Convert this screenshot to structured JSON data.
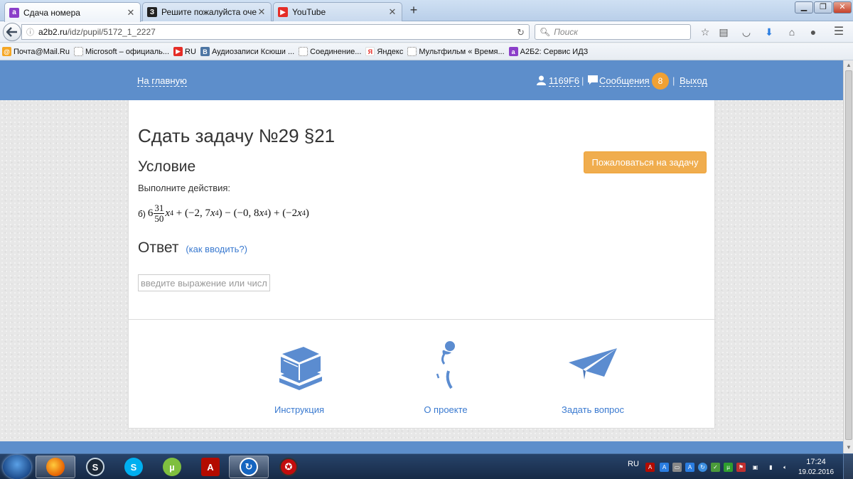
{
  "colors": {
    "header_blue": "#5d8ecb",
    "link_blue": "#3a7ad0",
    "orange": "#f0ad4e",
    "badge_orange": "#f0a134",
    "icon_blue": "#5b8cd0"
  },
  "browser": {
    "tabs": [
      {
        "label": "Сдача номера",
        "icon": "a2b2-icon",
        "active": true
      },
      {
        "label": "Решите пожалуйста очен...",
        "icon": "znanija-icon",
        "active": false
      },
      {
        "label": "YouTube",
        "icon": "youtube-icon",
        "active": false
      }
    ],
    "url": {
      "host": "a2b2.ru",
      "path": "/idz/pupil/5172_1_2227"
    },
    "search_placeholder": "Поиск",
    "bookmarks": [
      {
        "label": "Почта@Mail.Ru",
        "icon": "mailru-icon"
      },
      {
        "label": "Microsoft – официаль...",
        "icon": "blank-page-icon"
      },
      {
        "label": "RU",
        "icon": "youtube-icon"
      },
      {
        "label": "Аудиозаписи Ксюши ...",
        "icon": "vk-icon"
      },
      {
        "label": "Соединение...",
        "icon": "blank-page-icon"
      },
      {
        "label": "Яндекс",
        "icon": "yandex-icon"
      },
      {
        "label": "Мультфильм « Время...",
        "icon": "blank-page-icon"
      },
      {
        "label": "А2Б2: Сервис ИДЗ",
        "icon": "a2b2-icon"
      }
    ]
  },
  "site": {
    "header": {
      "home_link": "На главную",
      "user_id": "1169F6",
      "messages_link": "Сообщения",
      "messages_count": "8",
      "separator": "|",
      "logout_link": "Выход"
    },
    "page_title": "Сдать задачу №29 §21",
    "complain_button": "Пожаловаться на задачу",
    "condition_heading": "Условие",
    "task_text": "Выполните действия:",
    "formula": {
      "tag": "б)",
      "whole": "6",
      "numerator": "31",
      "denominator": "50",
      "var": "x",
      "exp": "4",
      "plus1": " + (−2, 7",
      "close_minus": ") − (−0, 8",
      "close_plus": ") + (−2",
      "close_end": ")"
    },
    "answer_heading": "Ответ",
    "how_to_enter_link": "(как вводить?)",
    "answer_placeholder": "введите выражение или число",
    "features": [
      {
        "label": "Инструкция",
        "icon": "books-icon"
      },
      {
        "label": "О проекте",
        "icon": "thinker-icon"
      },
      {
        "label": "Задать вопрос",
        "icon": "paper-plane-icon"
      }
    ]
  },
  "taskbar": {
    "apps": [
      "firefox-icon",
      "steam-icon",
      "skype-icon",
      "utorrent-icon",
      "acrobat-icon",
      "updater-icon",
      "game-icon"
    ],
    "lang": "RU",
    "time": "17:24",
    "date": "19.02.2016"
  }
}
